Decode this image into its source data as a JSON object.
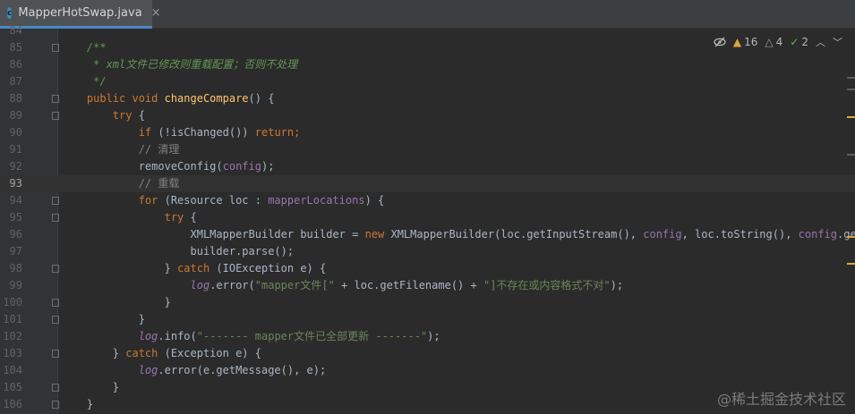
{
  "tab": {
    "icon_letter": "c",
    "label": "MapperHotSwap.java",
    "close": "×"
  },
  "inspections": {
    "warnings": "16",
    "weak_warnings": "4",
    "typos": "2",
    "icons": {
      "eye": "eye-crossed-icon",
      "warning": "warning-triangle-icon",
      "weak": "weak-warning-icon",
      "ok": "check-icon"
    }
  },
  "editor": {
    "top_partial_line": "84",
    "current_line": "93",
    "lines": [
      {
        "n": "85",
        "indent": "    ",
        "fold": true,
        "tokens": [
          {
            "c": "doc",
            "t": "/**"
          }
        ]
      },
      {
        "n": "86",
        "indent": "     ",
        "fold": false,
        "tokens": [
          {
            "c": "doc",
            "t": "* xml文件已修改则重载配置；否则不处理"
          }
        ]
      },
      {
        "n": "87",
        "indent": "     ",
        "fold": false,
        "tokens": [
          {
            "c": "doc",
            "t": "*/"
          }
        ]
      },
      {
        "n": "88",
        "indent": "    ",
        "fold": true,
        "tokens": [
          {
            "c": "kw",
            "t": "public "
          },
          {
            "c": "kw",
            "t": "void "
          },
          {
            "c": "fn",
            "t": "changeCompare"
          },
          {
            "c": "plain",
            "t": "() {"
          }
        ]
      },
      {
        "n": "89",
        "indent": "        ",
        "fold": true,
        "tokens": [
          {
            "c": "kw",
            "t": "try "
          },
          {
            "c": "plain",
            "t": "{"
          }
        ]
      },
      {
        "n": "90",
        "indent": "            ",
        "fold": false,
        "tokens": [
          {
            "c": "kw",
            "t": "if "
          },
          {
            "c": "plain",
            "t": "(!isChanged()) "
          },
          {
            "c": "kw",
            "t": "return;"
          }
        ]
      },
      {
        "n": "91",
        "indent": "            ",
        "fold": false,
        "tokens": [
          {
            "c": "cmt",
            "t": "// 清理"
          }
        ]
      },
      {
        "n": "92",
        "indent": "            ",
        "fold": false,
        "tokens": [
          {
            "c": "plain",
            "t": "removeConfig("
          },
          {
            "c": "field",
            "t": "config"
          },
          {
            "c": "plain",
            "t": ");"
          }
        ]
      },
      {
        "n": "93",
        "indent": "            ",
        "fold": false,
        "tokens": [
          {
            "c": "cmt",
            "t": "// 重载"
          }
        ]
      },
      {
        "n": "94",
        "indent": "            ",
        "fold": true,
        "tokens": [
          {
            "c": "kw",
            "t": "for "
          },
          {
            "c": "plain",
            "t": "(Resource loc : "
          },
          {
            "c": "field",
            "t": "mapperLocations"
          },
          {
            "c": "plain",
            "t": ") {"
          }
        ]
      },
      {
        "n": "95",
        "indent": "                ",
        "fold": true,
        "tokens": [
          {
            "c": "kw",
            "t": "try "
          },
          {
            "c": "plain",
            "t": "{"
          }
        ]
      },
      {
        "n": "96",
        "indent": "                    ",
        "fold": false,
        "tokens": [
          {
            "c": "plain",
            "t": "XMLMapperBuilder builder = "
          },
          {
            "c": "kw",
            "t": "new "
          },
          {
            "c": "plain",
            "t": "XMLMapperBuilder(loc.getInputStream(), "
          },
          {
            "c": "field",
            "t": "config"
          },
          {
            "c": "plain",
            "t": ", loc.toString(), "
          },
          {
            "c": "field",
            "t": "config"
          },
          {
            "c": "plain",
            "t": ".getSql"
          }
        ]
      },
      {
        "n": "97",
        "indent": "                    ",
        "fold": false,
        "tokens": [
          {
            "c": "plain",
            "t": "builder.parse();"
          }
        ]
      },
      {
        "n": "98",
        "indent": "                ",
        "fold": true,
        "tokens": [
          {
            "c": "plain",
            "t": "} "
          },
          {
            "c": "kw",
            "t": "catch "
          },
          {
            "c": "plain",
            "t": "(IOException e) {"
          }
        ]
      },
      {
        "n": "99",
        "indent": "                    ",
        "fold": false,
        "tokens": [
          {
            "c": "log",
            "t": "log"
          },
          {
            "c": "plain",
            "t": ".error("
          },
          {
            "c": "str",
            "t": "\"mapper文件[\" "
          },
          {
            "c": "plain",
            "t": "+ loc.getFilename() + "
          },
          {
            "c": "str",
            "t": "\"]不存在或内容格式不对\""
          },
          {
            "c": "plain",
            "t": ");"
          }
        ]
      },
      {
        "n": "100",
        "indent": "                ",
        "fold": true,
        "tokens": [
          {
            "c": "plain",
            "t": "}"
          }
        ]
      },
      {
        "n": "101",
        "indent": "            ",
        "fold": true,
        "tokens": [
          {
            "c": "plain",
            "t": "}"
          }
        ]
      },
      {
        "n": "102",
        "indent": "            ",
        "fold": false,
        "tokens": [
          {
            "c": "log",
            "t": "log"
          },
          {
            "c": "plain",
            "t": ".info("
          },
          {
            "c": "str",
            "t": "\"------- mapper文件已全部更新 -------\""
          },
          {
            "c": "plain",
            "t": ");"
          }
        ]
      },
      {
        "n": "103",
        "indent": "        ",
        "fold": true,
        "tokens": [
          {
            "c": "plain",
            "t": "} "
          },
          {
            "c": "kw",
            "t": "catch "
          },
          {
            "c": "plain",
            "t": "(Exception e) {"
          }
        ]
      },
      {
        "n": "104",
        "indent": "            ",
        "fold": false,
        "tokens": [
          {
            "c": "log",
            "t": "log"
          },
          {
            "c": "plain",
            "t": ".error(e.getMessage(), e);"
          }
        ]
      },
      {
        "n": "105",
        "indent": "        ",
        "fold": true,
        "tokens": [
          {
            "c": "plain",
            "t": "}"
          }
        ]
      },
      {
        "n": "106",
        "indent": "    ",
        "fold": true,
        "tokens": [
          {
            "c": "plain",
            "t": "}"
          }
        ]
      }
    ]
  },
  "watermark": "@稀土掘金技术社区",
  "colors": {
    "background": "#2b2b2b",
    "gutter": "#313335",
    "keyword": "#cc7832",
    "method": "#ffc66d",
    "field": "#9876aa",
    "string": "#6a8759",
    "comment": "#808080",
    "doc": "#629755",
    "warning_marker": "#e0a53c"
  }
}
